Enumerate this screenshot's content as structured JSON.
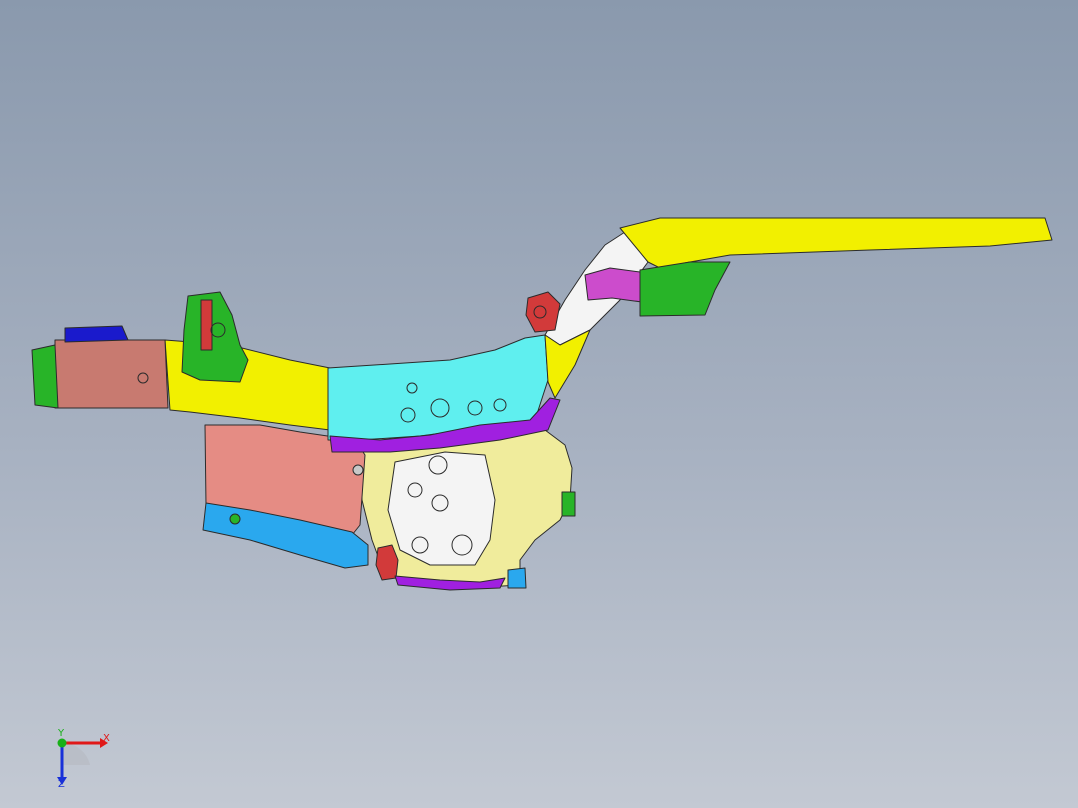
{
  "viewport": {
    "background_top": "#8a99ad",
    "background_bottom": "#c3c9d3"
  },
  "model": {
    "description_icon": "cad-assembly-body-frame",
    "part_colors": {
      "yellow": "#f2f000",
      "cyan": "#5fefef",
      "purple": "#a020e0",
      "salmon": "#e58c84",
      "brown": "#c87a70",
      "green": "#28b428",
      "pale_yellow": "#f0ec9c",
      "white": "#f4f4f4",
      "blue": "#2aa8ee",
      "navy": "#1a1acc",
      "red": "#d23a3a",
      "magenta": "#cc4ccc"
    }
  },
  "triad": {
    "x_label": "X",
    "y_label": "Y",
    "z_label": "Z",
    "x_color": "#e01818",
    "y_color": "#18b018",
    "z_color": "#1830d8"
  }
}
